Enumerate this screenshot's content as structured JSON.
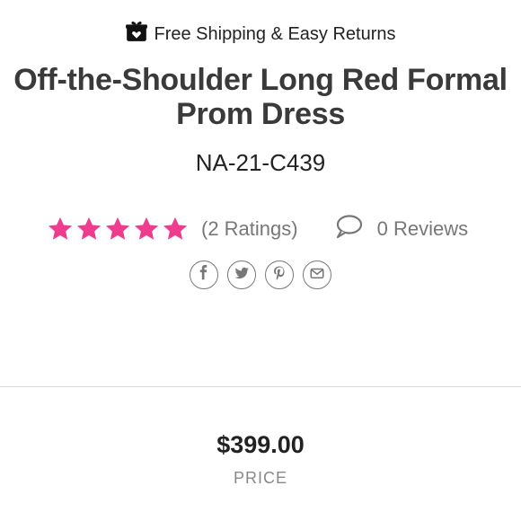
{
  "banner": {
    "text": "Free Shipping & Easy Returns",
    "icon": "gift-box-icon"
  },
  "product": {
    "title": "Off-the-Shoulder Long Red Formal Prom Dress",
    "sku": "NA-21-C439"
  },
  "rating": {
    "stars_filled": 5,
    "stars_total": 5,
    "ratings_text": "(2 Ratings)",
    "star_color": "#ee3d8f"
  },
  "reviews": {
    "text": "0 Reviews",
    "icon": "speech-bubble-icon"
  },
  "social": [
    "facebook-icon",
    "twitter-icon",
    "pinterest-icon",
    "email-icon"
  ],
  "price": {
    "value": "$399.00",
    "label": "PRICE"
  }
}
